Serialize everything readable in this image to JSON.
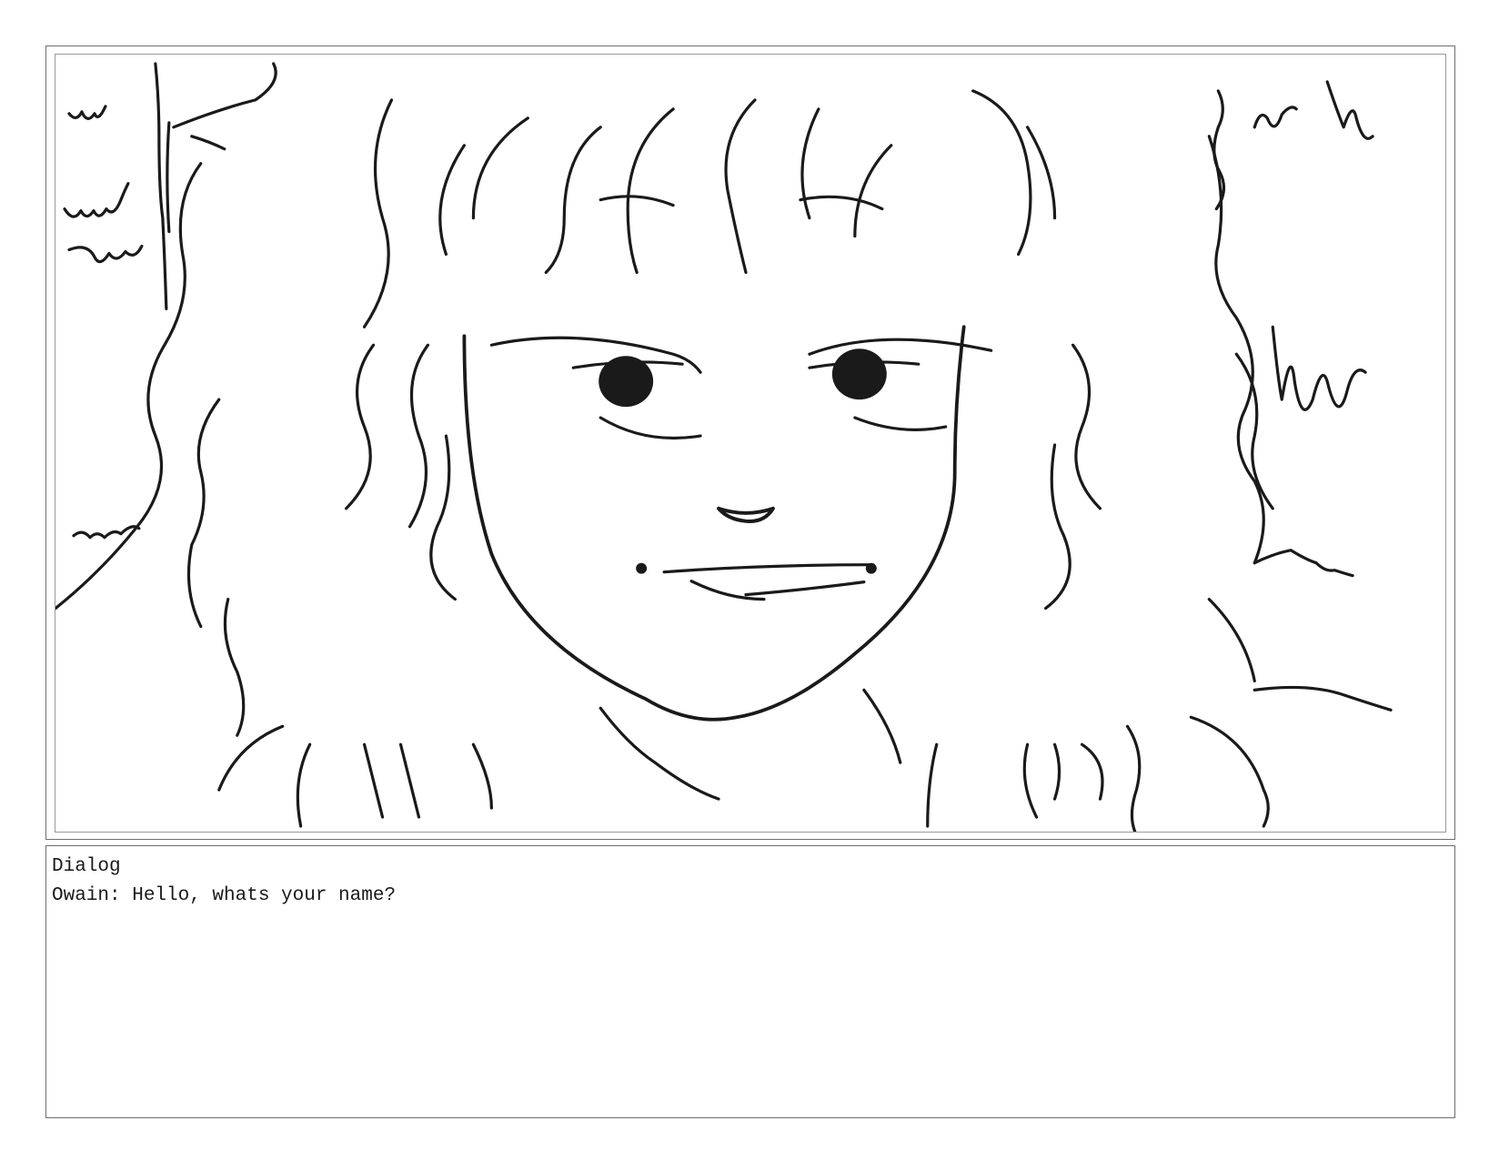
{
  "dialog": {
    "heading": "Dialog",
    "lines": [
      {
        "speaker": "Owain",
        "text": "Owain: Hello, whats your name?"
      }
    ]
  },
  "illustration": {
    "subject": "pencil-sketch portrait of a character with curly hair",
    "stroke_color": "#1a1a1a",
    "background_color": "#ffffff"
  }
}
